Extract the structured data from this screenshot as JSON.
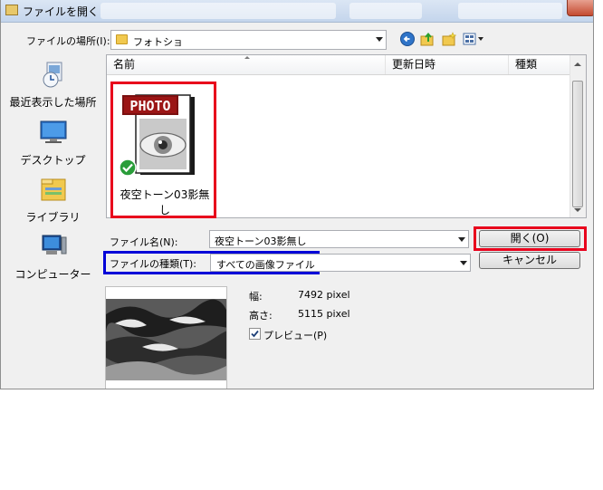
{
  "window": {
    "title": "ファイルを開く"
  },
  "lookin": {
    "label": "ファイルの場所(I):",
    "value": "フォトショ"
  },
  "places": [
    {
      "label": "最近表示した場所",
      "icon": "recent-places-icon"
    },
    {
      "label": "デスクトップ",
      "icon": "desktop-icon"
    },
    {
      "label": "ライブラリ",
      "icon": "libraries-icon"
    },
    {
      "label": "コンピューター",
      "icon": "computer-icon"
    }
  ],
  "columns": {
    "name": "名前",
    "date": "更新日時",
    "type": "種類"
  },
  "file": {
    "name": "夜空トーン03影無し",
    "name_line1": "夜空トーン03影無",
    "name_line2": "し",
    "badge": "PHOTO"
  },
  "filename": {
    "label": "ファイル名(N):",
    "value": "夜空トーン03影無し"
  },
  "filetype": {
    "label": "ファイルの種類(T):",
    "value": "すべての画像ファイル"
  },
  "buttons": {
    "open": "開く(O)",
    "cancel": "キャンセル"
  },
  "info": {
    "width_label": "幅:",
    "width_value": "7492 pixel",
    "height_label": "高さ:",
    "height_value": "5115 pixel"
  },
  "preview_toggle": {
    "label": "プレビュー(P)",
    "checked": true
  },
  "colors": {
    "highlight_red": "#e8001c",
    "highlight_blue": "#0000d8"
  }
}
